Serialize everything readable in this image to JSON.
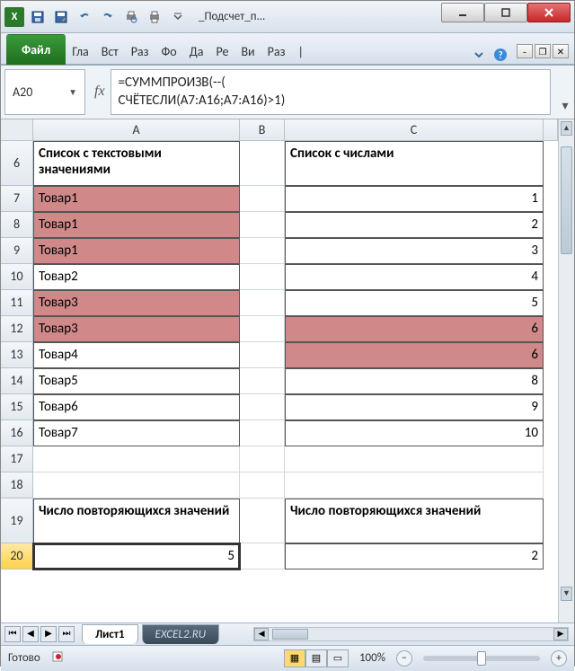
{
  "chart_data": {
    "type": "table",
    "columns": [
      "A: Список с текстовыми значениями",
      "C: Список с числами"
    ],
    "rows": [
      [
        "Товар1",
        1
      ],
      [
        "Товар1",
        2
      ],
      [
        "Товар1",
        3
      ],
      [
        "Товар2",
        4
      ],
      [
        "Товар3",
        5
      ],
      [
        "Товар3",
        6
      ],
      [
        "Товар4",
        6
      ],
      [
        "Товар5",
        8
      ],
      [
        "Товар6",
        9
      ],
      [
        "Товар7",
        10
      ]
    ],
    "summary": {
      "A20_label": "Число повторяющихся значений",
      "duplicate_count_A": 5,
      "duplicate_count_C": 2
    },
    "highlighted": {
      "A": [
        7,
        8,
        9,
        11,
        12
      ],
      "C": [
        12,
        13
      ]
    }
  },
  "window": {
    "title": "_Подсчет_п..."
  },
  "ribbon": {
    "file": "Файл",
    "tabs": [
      "Гла",
      "Вст",
      "Раз",
      "Фо",
      "Да",
      "Ре",
      "Ви",
      "Раз",
      "|"
    ]
  },
  "formula_bar": {
    "name_box": "A20",
    "fx_label": "fx",
    "formula_line1": "=СУММПРОИЗВ(--(",
    "formula_line2": "СЧЁТЕСЛИ(A7:A16;A7:A16)>1)"
  },
  "columns": {
    "A": "A",
    "B": "B",
    "C": "C"
  },
  "row_labels": [
    "6",
    "7",
    "8",
    "9",
    "10",
    "11",
    "12",
    "13",
    "14",
    "15",
    "16",
    "17",
    "18",
    "19",
    "20"
  ],
  "headers": {
    "A6": "Список с текстовыми значениями",
    "C6": "Список с числами",
    "A19": "Число повторяющихся значений",
    "C19": "Число повторяющихся значений"
  },
  "dataA": [
    "Товар1",
    "Товар1",
    "Товар1",
    "Товар2",
    "Товар3",
    "Товар3",
    "Товар4",
    "Товар5",
    "Товар6",
    "Товар7"
  ],
  "dataC": [
    "1",
    "2",
    "3",
    "4",
    "5",
    "6",
    "6",
    "8",
    "9",
    "10"
  ],
  "results": {
    "A20": "5",
    "C20": "2"
  },
  "sheets": {
    "active": "Лист1",
    "other": "EXCEL2.RU"
  },
  "status": {
    "ready": "Готово",
    "zoom": "100%"
  }
}
